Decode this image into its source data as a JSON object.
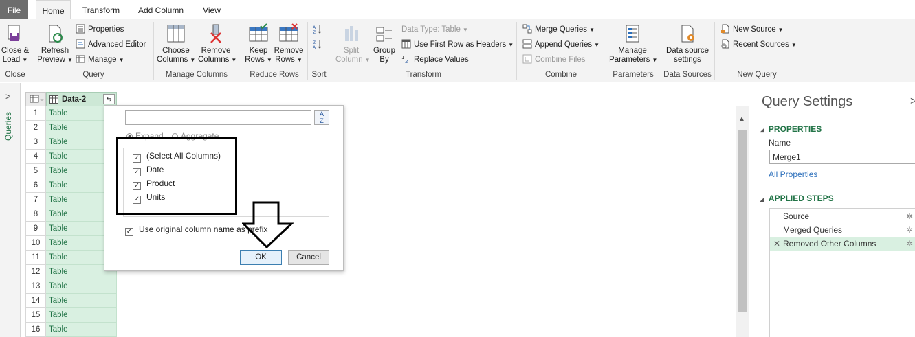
{
  "tabs": [
    "File",
    "Home",
    "Transform",
    "Add Column",
    "View"
  ],
  "ribbon": {
    "close": {
      "btn1": "Close &",
      "btn2": "Load",
      "label": "Close"
    },
    "query": {
      "refresh1": "Refresh",
      "refresh2": "Preview",
      "properties": "Properties",
      "advanced_editor": "Advanced Editor",
      "manage": "Manage",
      "label": "Query"
    },
    "manage_columns": {
      "choose1": "Choose",
      "choose2": "Columns",
      "remove1": "Remove",
      "remove2": "Columns",
      "label": "Manage Columns"
    },
    "reduce_rows": {
      "keep1": "Keep",
      "keep2": "Rows",
      "remove1": "Remove",
      "remove2": "Rows",
      "label": "Reduce Rows"
    },
    "sort": {
      "label": "Sort"
    },
    "transform": {
      "split1": "Split",
      "split2": "Column",
      "group1": "Group",
      "group2": "By",
      "data_type": "Data Type: Table",
      "first_row": "Use First Row as Headers",
      "replace": "Replace Values",
      "label": "Transform"
    },
    "combine": {
      "merge": "Merge Queries",
      "append": "Append Queries",
      "combine_files": "Combine Files",
      "label": "Combine"
    },
    "parameters": {
      "manage1": "Manage",
      "manage2": "Parameters",
      "label": "Parameters"
    },
    "data_sources": {
      "btn1": "Data source",
      "btn2": "settings",
      "label": "Data Sources"
    },
    "new_query": {
      "new_source": "New Source",
      "recent": "Recent Sources",
      "label": "New Query"
    }
  },
  "leftnav": {
    "queries_label": "Queries"
  },
  "grid": {
    "column_name": "Data-2",
    "rows": [
      "1",
      "2",
      "3",
      "4",
      "5",
      "6",
      "7",
      "8",
      "9",
      "10",
      "11",
      "12",
      "13",
      "14",
      "15",
      "16"
    ],
    "cell_value": "Table"
  },
  "dialog": {
    "search_value": "",
    "expand_label": "Expand",
    "aggregate_label": "Aggregate",
    "columns": [
      {
        "label": "(Select All Columns)",
        "checked": true
      },
      {
        "label": "Date",
        "checked": true
      },
      {
        "label": "Product",
        "checked": true
      },
      {
        "label": "Units",
        "checked": true
      }
    ],
    "prefix_label": "Use original column name as prefix",
    "prefix_checked": true,
    "ok": "OK",
    "cancel": "Cancel"
  },
  "query_settings": {
    "title": "Query Settings",
    "properties_heading": "PROPERTIES",
    "name_label": "Name",
    "name_value": "Merge1",
    "all_properties": "All Properties",
    "applied_steps_heading": "APPLIED STEPS",
    "steps": [
      "Source",
      "Merged Queries",
      "Removed Other Columns"
    ]
  }
}
